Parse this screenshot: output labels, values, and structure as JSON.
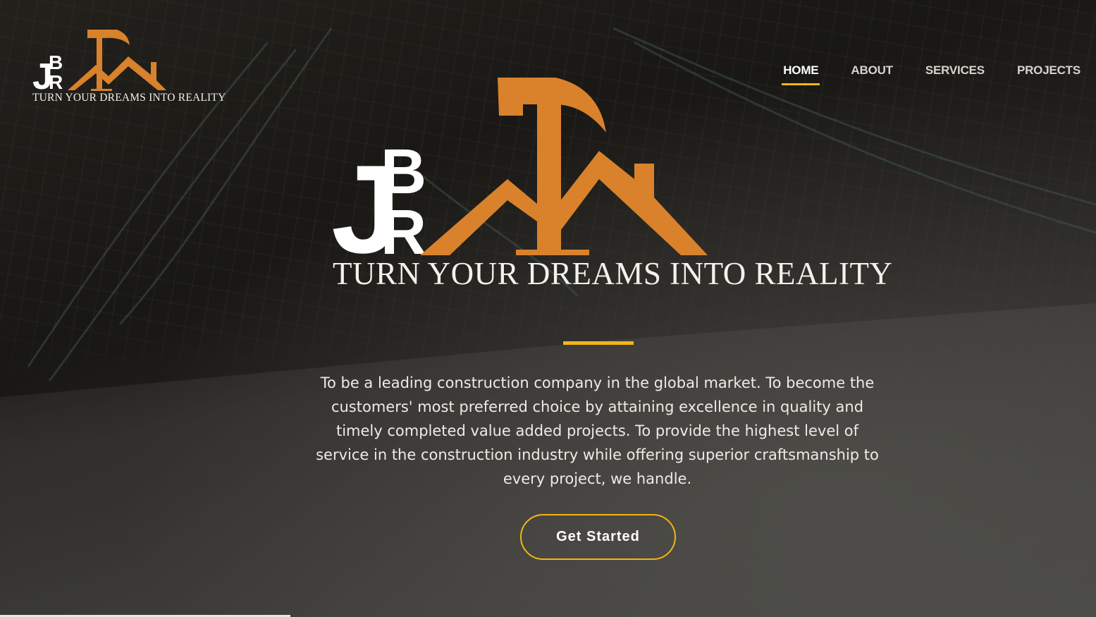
{
  "header": {
    "logo_letters": "JBR",
    "logo_tagline": "TURN YOUR DREAMS INTO REALITY"
  },
  "nav": {
    "items": [
      {
        "label": "HOME",
        "active": true
      },
      {
        "label": "ABOUT",
        "active": false
      },
      {
        "label": "SERVICES",
        "active": false
      },
      {
        "label": "PROJECTS",
        "active": false
      }
    ]
  },
  "hero": {
    "logo_letters": "JBR",
    "tagline": "TURN YOUR DREAMS INTO REALITY",
    "mission": "To be a leading construction company in the global market. To become the customers' most preferred choice by attaining excellence in quality and timely completed value added projects. To provide the highest level of service in the construction industry while offering superior craftsmanship to every project, we handle.",
    "cta_label": "Get Started"
  },
  "colors": {
    "accent": "#f2b515",
    "logo_orange": "#d9822b",
    "text": "#ffffff"
  },
  "icons": {
    "logo_mark": "hammer-roof-icon"
  }
}
